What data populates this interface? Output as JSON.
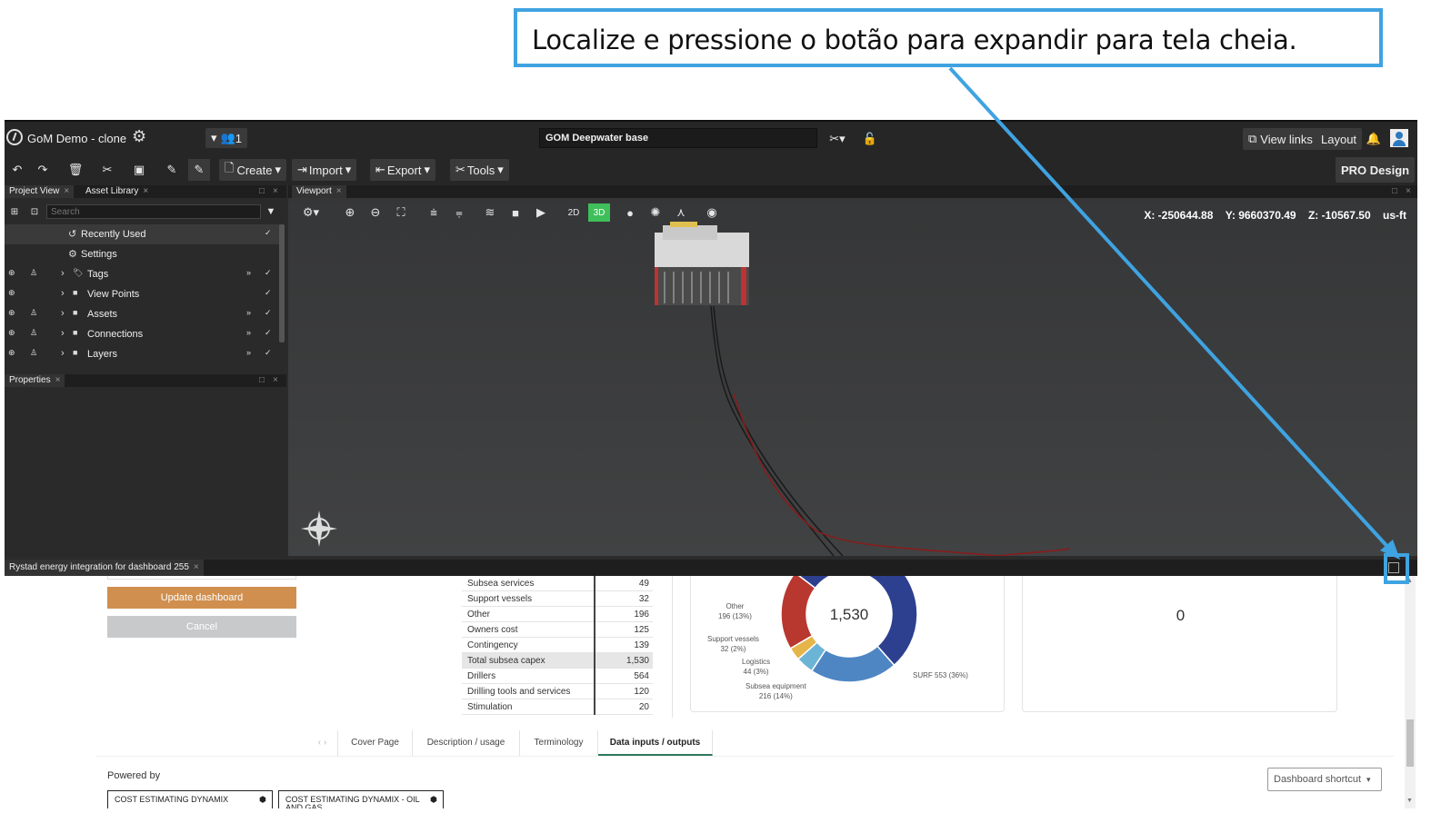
{
  "instruction": "Localize e pressione o botão para expandir para tela cheia.",
  "header": {
    "project_name": "GoM Demo - clone",
    "users_count": "1",
    "search_value": "GOM Deepwater base",
    "view_links": "View links",
    "layout": "Layout",
    "pro_design": "PRO Design"
  },
  "toolbar": {
    "create": "Create",
    "import": "Import",
    "export": "Export",
    "tools": "Tools"
  },
  "left_panel": {
    "tabs": [
      "Project View",
      "Asset Library"
    ],
    "search_placeholder": "Search",
    "items": [
      {
        "label": "Recently Used"
      },
      {
        "label": "Settings"
      },
      {
        "label": "Tags"
      },
      {
        "label": "View Points"
      },
      {
        "label": "Assets"
      },
      {
        "label": "Connections"
      },
      {
        "label": "Layers"
      }
    ],
    "properties_tab": "Properties"
  },
  "viewport": {
    "tab": "Viewport",
    "mode_2d": "2D",
    "mode_3d": "3D",
    "coords": {
      "x_label": "X:",
      "x": "-250644.88",
      "y_label": "Y:",
      "y": "9660370.49",
      "z_label": "Z:",
      "z": "-10567.50",
      "units": "us-ft"
    }
  },
  "dashboard": {
    "panel_tab": "Rystad energy integration for dashboard 255",
    "update_label": "Update dashboard",
    "cancel_label": "Cancel",
    "table": [
      {
        "name": "Subsea services",
        "value": "49"
      },
      {
        "name": "Support vessels",
        "value": "32"
      },
      {
        "name": "Other",
        "value": "196"
      },
      {
        "name": "Owners cost",
        "value": "125"
      },
      {
        "name": "Contingency",
        "value": "139"
      },
      {
        "name": "Total subsea capex",
        "value": "1,530"
      },
      {
        "name": "Drillers",
        "value": "564"
      },
      {
        "name": "Drilling tools and services",
        "value": "120"
      },
      {
        "name": "Stimulation",
        "value": "20"
      }
    ],
    "second_card_value": "0",
    "tabs": [
      "Cover Page",
      "Description / usage",
      "Terminology",
      "Data inputs / outputs"
    ],
    "powered_by": "Powered by",
    "logos": [
      "COST ESTIMATING DYNAMIX",
      "COST ESTIMATING DYNAMIX - OIL AND GAS"
    ],
    "shortcut_label": "Dashboard shortcut"
  },
  "chart_data": {
    "type": "pie",
    "center_label": "1,530",
    "slices": [
      {
        "label": "SURF",
        "text": "SURF 553 (36%)",
        "value": 553,
        "percent": 36,
        "color": "#2d3f8f"
      },
      {
        "label": "Subsea equipment",
        "text": "216 (14%)",
        "value": 216,
        "percent": 14,
        "color": "#4e86c4"
      },
      {
        "label": "Logistics",
        "text": "44 (3%)",
        "value": 44,
        "percent": 3,
        "color": "#6cb4d6"
      },
      {
        "label": "Support vessels",
        "text": "32 (2%)",
        "value": 32,
        "percent": 2,
        "color": "#e6b54a"
      },
      {
        "label": "Other",
        "text": "196 (13%)",
        "value": 196,
        "percent": 13,
        "color": "#b8372f"
      }
    ]
  }
}
